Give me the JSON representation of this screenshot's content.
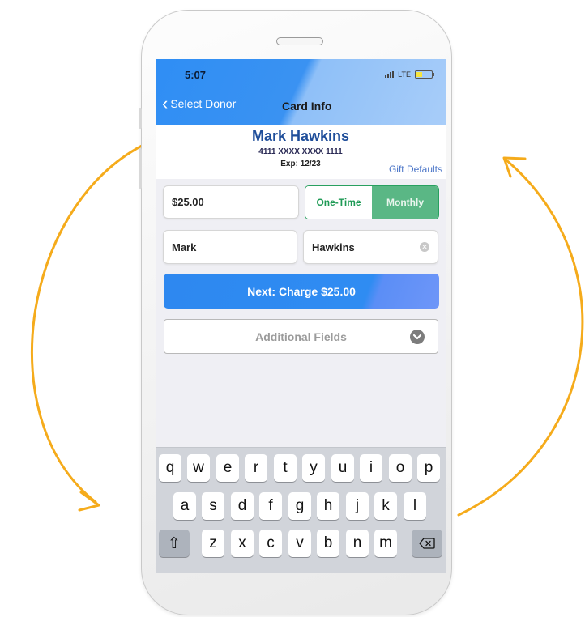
{
  "status_bar": {
    "time": "5:07",
    "network": "LTE"
  },
  "nav": {
    "back_label": "Select Donor",
    "title": "Card Info"
  },
  "donor": {
    "name": "Mark Hawkins",
    "card_number": "4111 XXXX XXXX 1111",
    "expiration": "Exp: 12/23",
    "gift_defaults_label": "Gift Defaults"
  },
  "form": {
    "amount": "$25.00",
    "frequency_options": [
      "One-Time",
      "Monthly"
    ],
    "frequency_selected": "Monthly",
    "first_name": "Mark",
    "last_name": "Hawkins",
    "charge_button_label": "Next: Charge $25.00",
    "additional_fields_label": "Additional Fields"
  },
  "keyboard": {
    "row1": [
      "q",
      "w",
      "e",
      "r",
      "t",
      "y",
      "u",
      "i",
      "o",
      "p"
    ],
    "row2": [
      "a",
      "s",
      "d",
      "f",
      "g",
      "h",
      "j",
      "k",
      "l"
    ],
    "row3": [
      "z",
      "x",
      "c",
      "v",
      "b",
      "n",
      "m"
    ],
    "shift_symbol": "⇧"
  },
  "colors": {
    "header_blue": "#2f8ef4",
    "donor_name": "#1f4e9a",
    "toggle_green": "#29a060",
    "arrow_orange": "#f5ab1b"
  }
}
